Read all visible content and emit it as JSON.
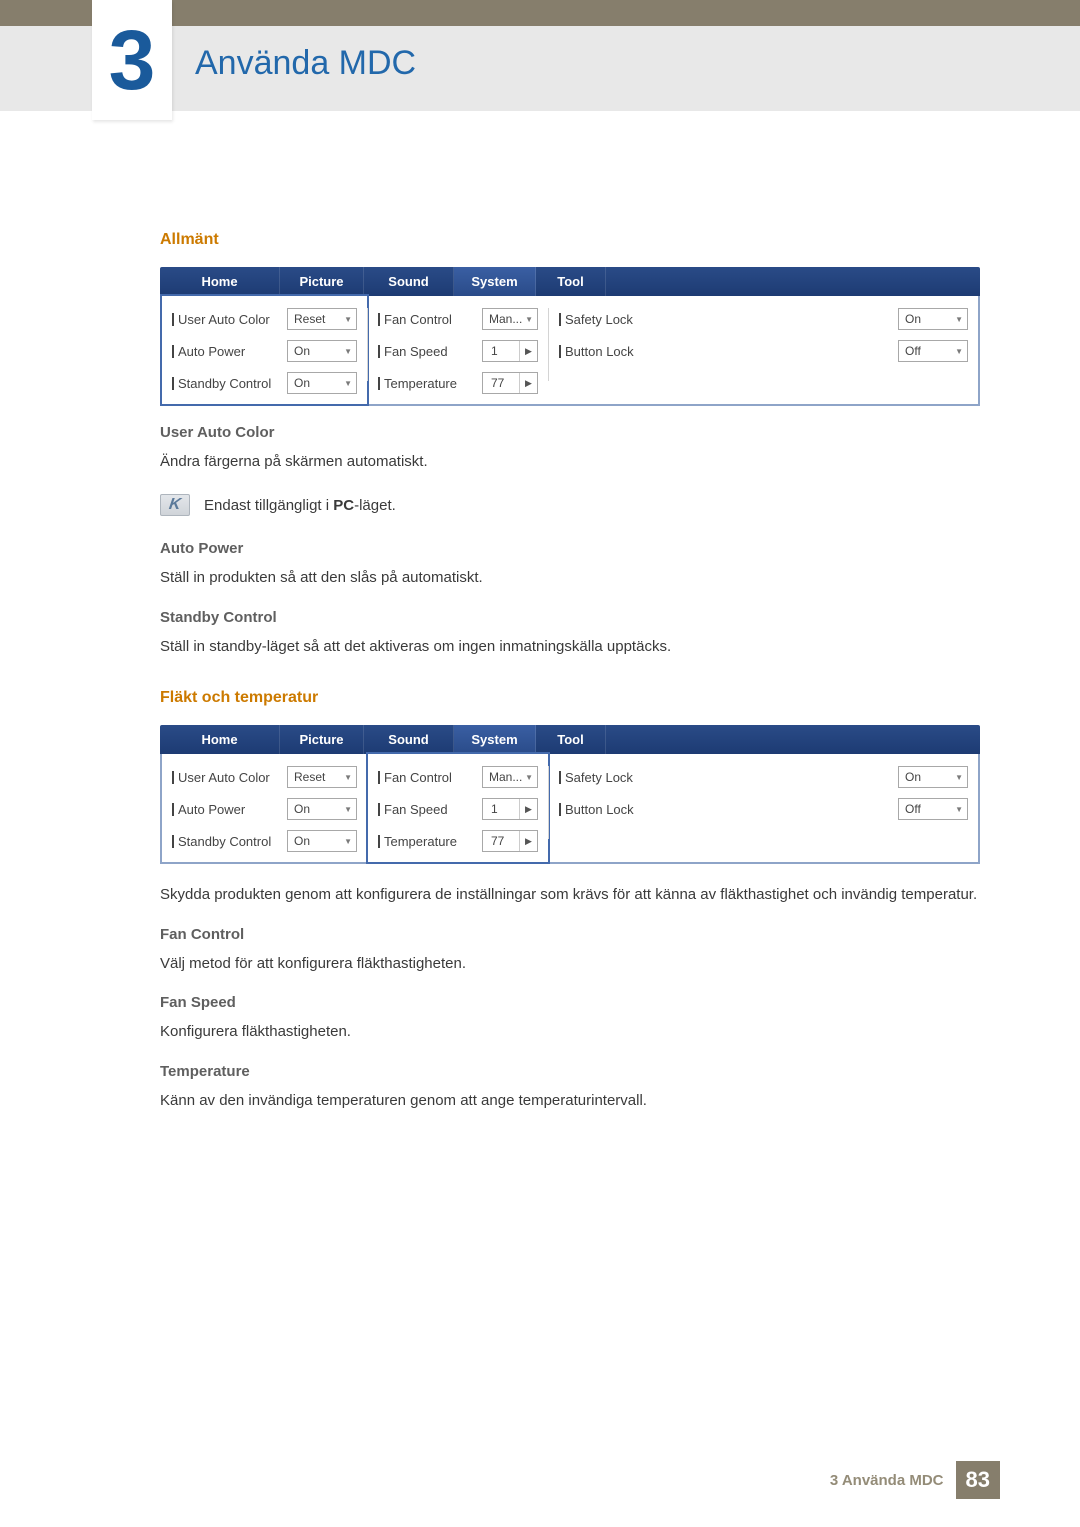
{
  "chapter": {
    "number": "3",
    "title": "Använda MDC"
  },
  "sections": {
    "general": {
      "heading": "Allmänt",
      "uac": {
        "title": "User Auto Color",
        "text": "Ändra färgerna på skärmen automatiskt.",
        "note_prefix": "Endast tillgängligt i ",
        "note_bold": "PC",
        "note_suffix": "-läget."
      },
      "ap": {
        "title": "Auto Power",
        "text": "Ställ in produkten så att den slås på automatiskt."
      },
      "sc": {
        "title": "Standby Control",
        "text": "Ställ in standby-läget så att det aktiveras om ingen inmatningskälla upptäcks."
      }
    },
    "fan": {
      "heading": "Fläkt och temperatur",
      "intro": "Skydda produkten genom att konfigurera de inställningar som krävs för att känna av fläkthastighet och invändig temperatur.",
      "fc": {
        "title": "Fan Control",
        "text": "Välj metod för att konfigurera fläkthastigheten."
      },
      "fs": {
        "title": "Fan Speed",
        "text": "Konfigurera fläkthastigheten."
      },
      "tp": {
        "title": "Temperature",
        "text": "Känn av den invändiga temperaturen genom att ange temperaturintervall."
      }
    }
  },
  "tabs": {
    "home": "Home",
    "picture": "Picture",
    "sound": "Sound",
    "system": "System",
    "tool": "Tool"
  },
  "panel": {
    "col0": {
      "user_auto_color": "User Auto Color",
      "auto_power": "Auto Power",
      "standby_control": "Standby Control",
      "reset": "Reset",
      "on": "On"
    },
    "col1": {
      "fan_control": "Fan Control",
      "fan_speed": "Fan Speed",
      "temperature": "Temperature",
      "man": "Man...",
      "v1": "1",
      "v77": "77"
    },
    "col2": {
      "safety_lock": "Safety Lock",
      "button_lock": "Button Lock",
      "on": "On",
      "off": "Off"
    }
  },
  "footer": {
    "text": "3 Använda MDC",
    "page": "83"
  }
}
